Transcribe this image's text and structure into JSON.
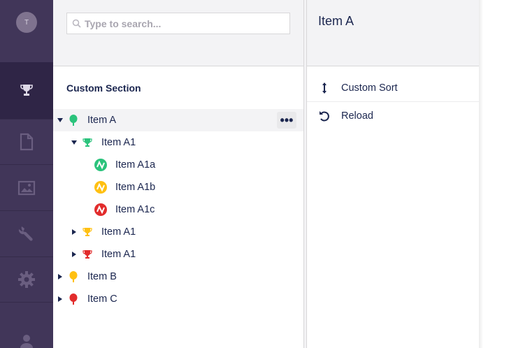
{
  "sidebar": {
    "avatar_initial": "T",
    "items": [
      {
        "icon": "trophy-icon",
        "active": true
      },
      {
        "icon": "document-icon",
        "active": false
      },
      {
        "icon": "image-icon",
        "active": false
      },
      {
        "icon": "wrench-icon",
        "active": false
      },
      {
        "icon": "gear-icon",
        "active": false
      },
      {
        "icon": "user-icon",
        "active": false
      }
    ]
  },
  "search": {
    "placeholder": "Type to search..."
  },
  "tree": {
    "section_title": "Custom Section",
    "nodes": [
      {
        "label": "Item A",
        "icon": "tree-icon",
        "color": "#2bc37c",
        "expanded": true,
        "selected": true
      },
      {
        "label": "Item A1",
        "icon": "trophy-icon",
        "color": "#2bc37c",
        "expanded": true
      },
      {
        "label": "Item A1a",
        "icon": "wave-icon",
        "color": "#2bc37c"
      },
      {
        "label": "Item A1b",
        "icon": "wave-icon",
        "color": "#ffc012"
      },
      {
        "label": "Item A1c",
        "icon": "wave-icon",
        "color": "#e22c2c"
      },
      {
        "label": "Item A1",
        "icon": "trophy-icon",
        "color": "#ffc012",
        "expanded": false
      },
      {
        "label": "Item A1",
        "icon": "trophy-icon",
        "color": "#e22c2c",
        "expanded": false
      },
      {
        "label": "Item B",
        "icon": "tree-icon",
        "color": "#ffc012",
        "expanded": false
      },
      {
        "label": "Item C",
        "icon": "tree-icon",
        "color": "#e22c2c",
        "expanded": false
      }
    ],
    "more_label": "•••"
  },
  "actions": {
    "title": "Item A",
    "items": [
      {
        "label": "Custom Sort",
        "icon": "sort-icon"
      },
      {
        "label": "Reload",
        "icon": "reload-icon"
      }
    ]
  }
}
